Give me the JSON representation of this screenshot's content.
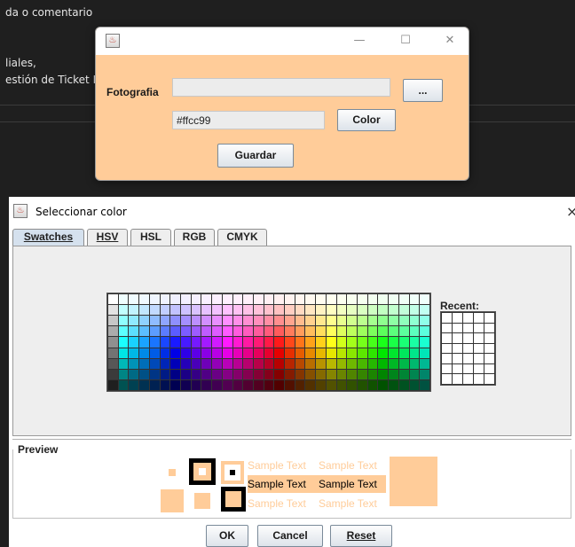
{
  "background_app": {
    "line1": "da o comentario",
    "line2": "liales,",
    "line3": "estión de Ticket I"
  },
  "frame": {
    "controls": {
      "minimize": "—",
      "maximize": "☐",
      "close": "✕"
    },
    "photo_label": "Fotografia",
    "photo_value": "",
    "browse_label": "...",
    "color_value": "#ffcc99",
    "color_button": "Color",
    "save_button": "Guardar",
    "bg_color": "#ffcc99"
  },
  "chooser": {
    "title": "Seleccionar color",
    "close": "×",
    "tabs": [
      "Swatches",
      "HSV",
      "HSL",
      "RGB",
      "CMYK"
    ],
    "active_tab": "Swatches",
    "recent_label": "Recent:",
    "preview_label": "Preview",
    "sample_text": "Sample Text",
    "ok": "OK",
    "cancel": "Cancel",
    "reset": "Reset",
    "selected_color": "#ffcc99"
  }
}
